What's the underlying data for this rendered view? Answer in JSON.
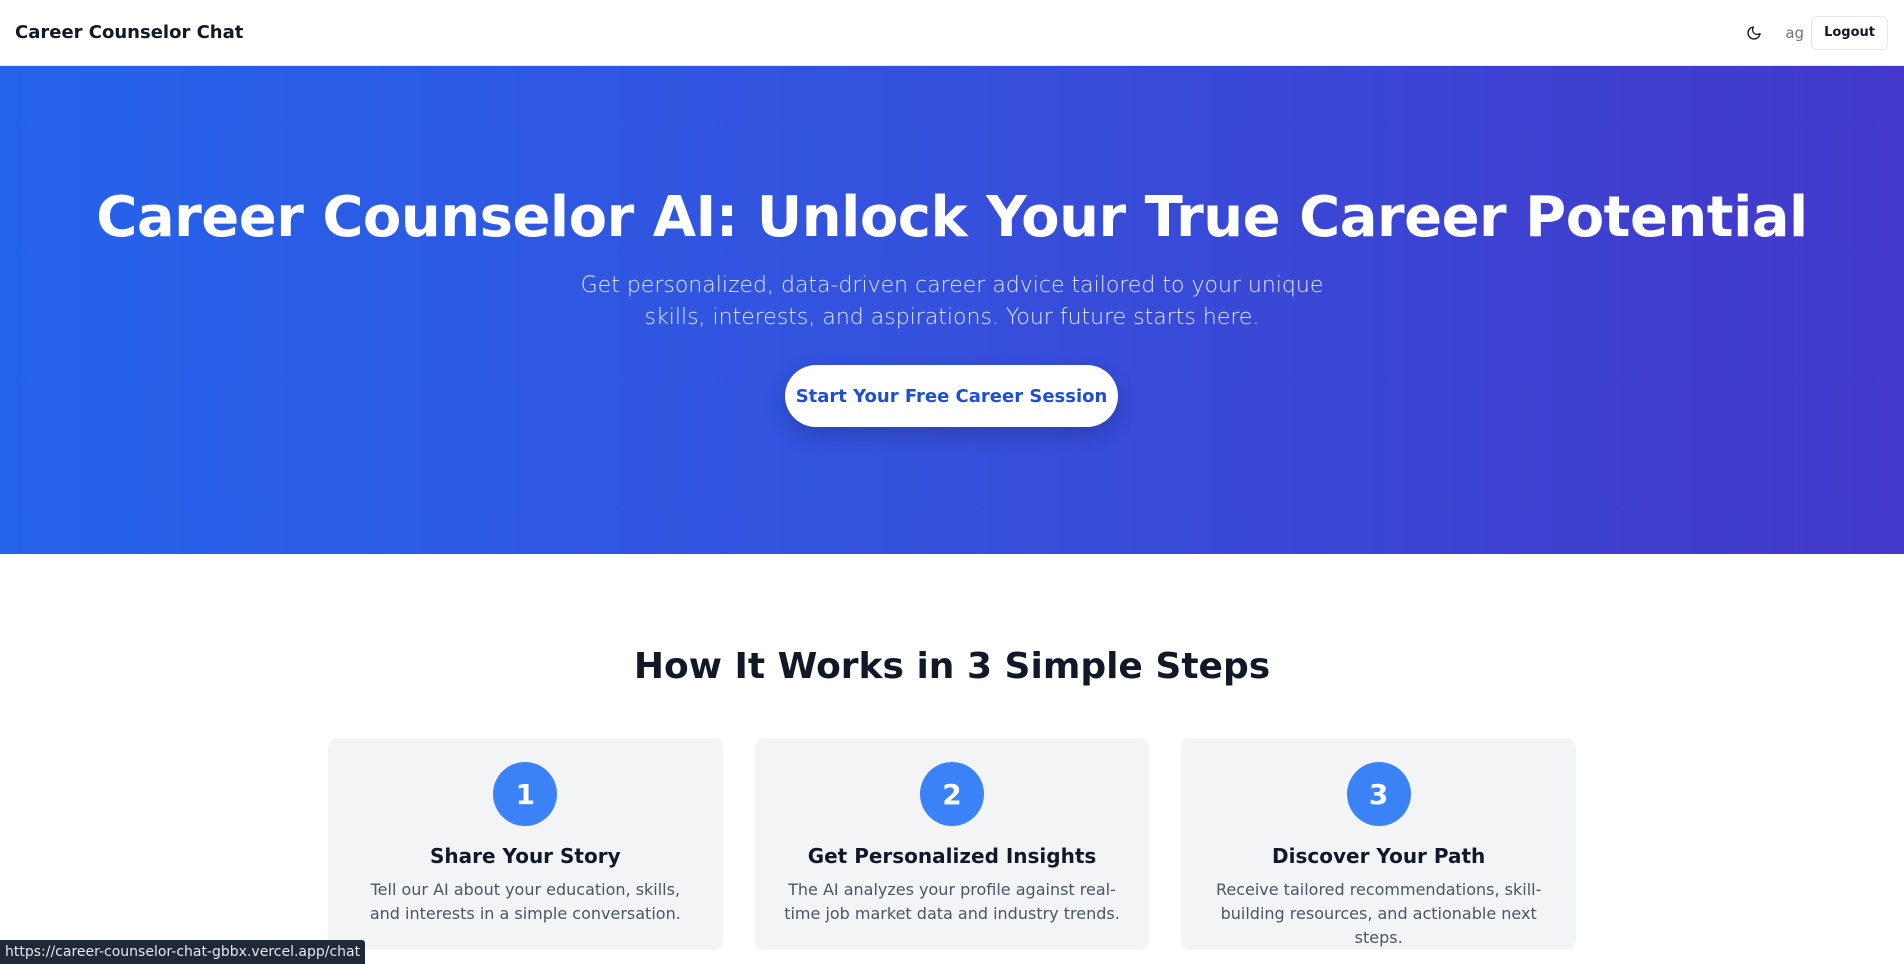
{
  "nav": {
    "brand": "Career Counselor Chat",
    "user_initials": "ag",
    "logout_label": "Logout",
    "theme_icon": "moon-icon"
  },
  "hero": {
    "title": "Career Counselor AI: Unlock Your True Career Potential",
    "subtitle": "Get personalized, data-driven career advice tailored to your unique skills, interests, and aspirations. Your future starts here.",
    "cta_label": "Start Your Free Career Session"
  },
  "steps": {
    "title": "How It Works in 3 Simple Steps",
    "items": [
      {
        "number": "1",
        "title": "Share Your Story",
        "description": "Tell our AI about your education, skills, and interests in a simple conversation."
      },
      {
        "number": "2",
        "title": "Get Personalized Insights",
        "description": "The AI analyzes your profile against real-time job market data and industry trends."
      },
      {
        "number": "3",
        "title": "Discover Your Path",
        "description": "Receive tailored recommendations, skill-building resources, and actionable next steps."
      }
    ]
  },
  "status_bar": {
    "url": "https://career-counselor-chat-gbbx.vercel.app/chat"
  },
  "colors": {
    "hero_gradient_start": "#2563eb",
    "hero_gradient_end": "#4338ca",
    "step_circle": "#3b82f6",
    "card_bg": "#f3f4f6"
  }
}
